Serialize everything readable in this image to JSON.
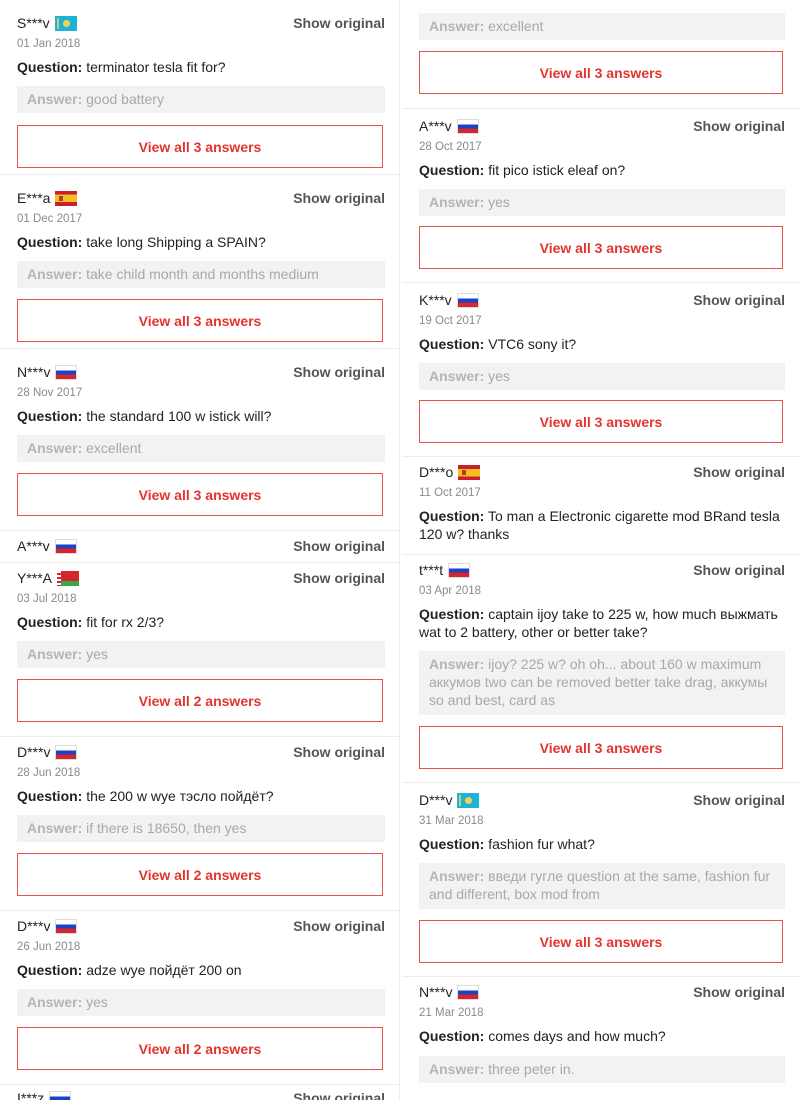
{
  "labels": {
    "show_original": "Show original",
    "question_prefix": "Question:",
    "answer_prefix": "Answer:"
  },
  "left": [
    {
      "user": "S***v",
      "flag": "kz-flag-icon",
      "date": "01 Jan 2018",
      "question": "terminator tesla fit for?",
      "answer": "good battery",
      "view_all": "View all 3 answers"
    },
    {
      "user": "E***a",
      "flag": "es-flag-icon",
      "date": "01 Dec 2017",
      "question": "take long Shipping a SPAIN?",
      "answer": "take child month and months medium",
      "view_all": "View all 3 answers"
    },
    {
      "user": "N***v",
      "flag": "ru-flag-icon",
      "date": "28 Nov 2017",
      "question": "the standard 100 w istick will?",
      "answer": "excellent",
      "view_all": "View all 3 answers"
    },
    {
      "user": "A***v",
      "flag": "ru-flag-icon"
    },
    {
      "user": "Y***A",
      "flag": "by-flag-icon",
      "date": "03 Jul 2018",
      "question": "fit for rx 2/3?",
      "answer": "yes",
      "view_all": "View all 2 answers"
    },
    {
      "user": "D***v",
      "flag": "ru-flag-icon",
      "date": "28 Jun 2018",
      "question": "the 200 w wye тэсло пойдёт?",
      "answer": "if there is 18650, then yes",
      "view_all": "View all 2 answers"
    },
    {
      "user": "D***v",
      "flag": "ru-flag-icon",
      "date": "26 Jun 2018",
      "question": "adze wye пойдёт 200 on",
      "answer": "yes",
      "view_all": "View all 2 answers"
    },
    {
      "user": "I***z",
      "flag": "ru-flag-icon"
    }
  ],
  "right": [
    {
      "answer": "excellent",
      "view_all": "View all 3 answers"
    },
    {
      "user": "A***v",
      "flag": "ru-flag-icon",
      "date": "28 Oct 2017",
      "question": "fit pico istick eleaf on?",
      "answer": "yes",
      "view_all": "View all 3 answers"
    },
    {
      "user": "K***v",
      "flag": "ru-flag-icon",
      "date": "19 Oct 2017",
      "question": "VTC6 sony it?",
      "answer": "yes",
      "view_all": "View all 3 answers"
    },
    {
      "user": "D***o",
      "flag": "es-flag-icon",
      "date": "11 Oct 2017",
      "question": "To man a Electronic cigarette mod BRand tesla 120 w? thanks"
    },
    {
      "user": "t***t",
      "flag": "ru-flag-icon",
      "date": "03 Apr 2018",
      "question": "captain ijoy take to 225 w, how much выжмать wat to 2 battery, other or better take?",
      "answer": "ijoy? 225 w? oh oh... about 160 w maximum аккумов two can be removed better take drag, аккумы so and best, card as",
      "view_all": "View all 3 answers"
    },
    {
      "user": "D***v",
      "flag": "kz-flag-icon",
      "date": "31 Mar 2018",
      "question": "fashion fur what?",
      "answer": "введи гугле question at the same, fashion fur and different, box mod from",
      "view_all": "View all 3 answers"
    },
    {
      "user": "N***v",
      "flag": "ru-flag-icon",
      "date": "21 Mar 2018",
      "question": "comes days and how much?",
      "answer": "three peter in."
    }
  ]
}
